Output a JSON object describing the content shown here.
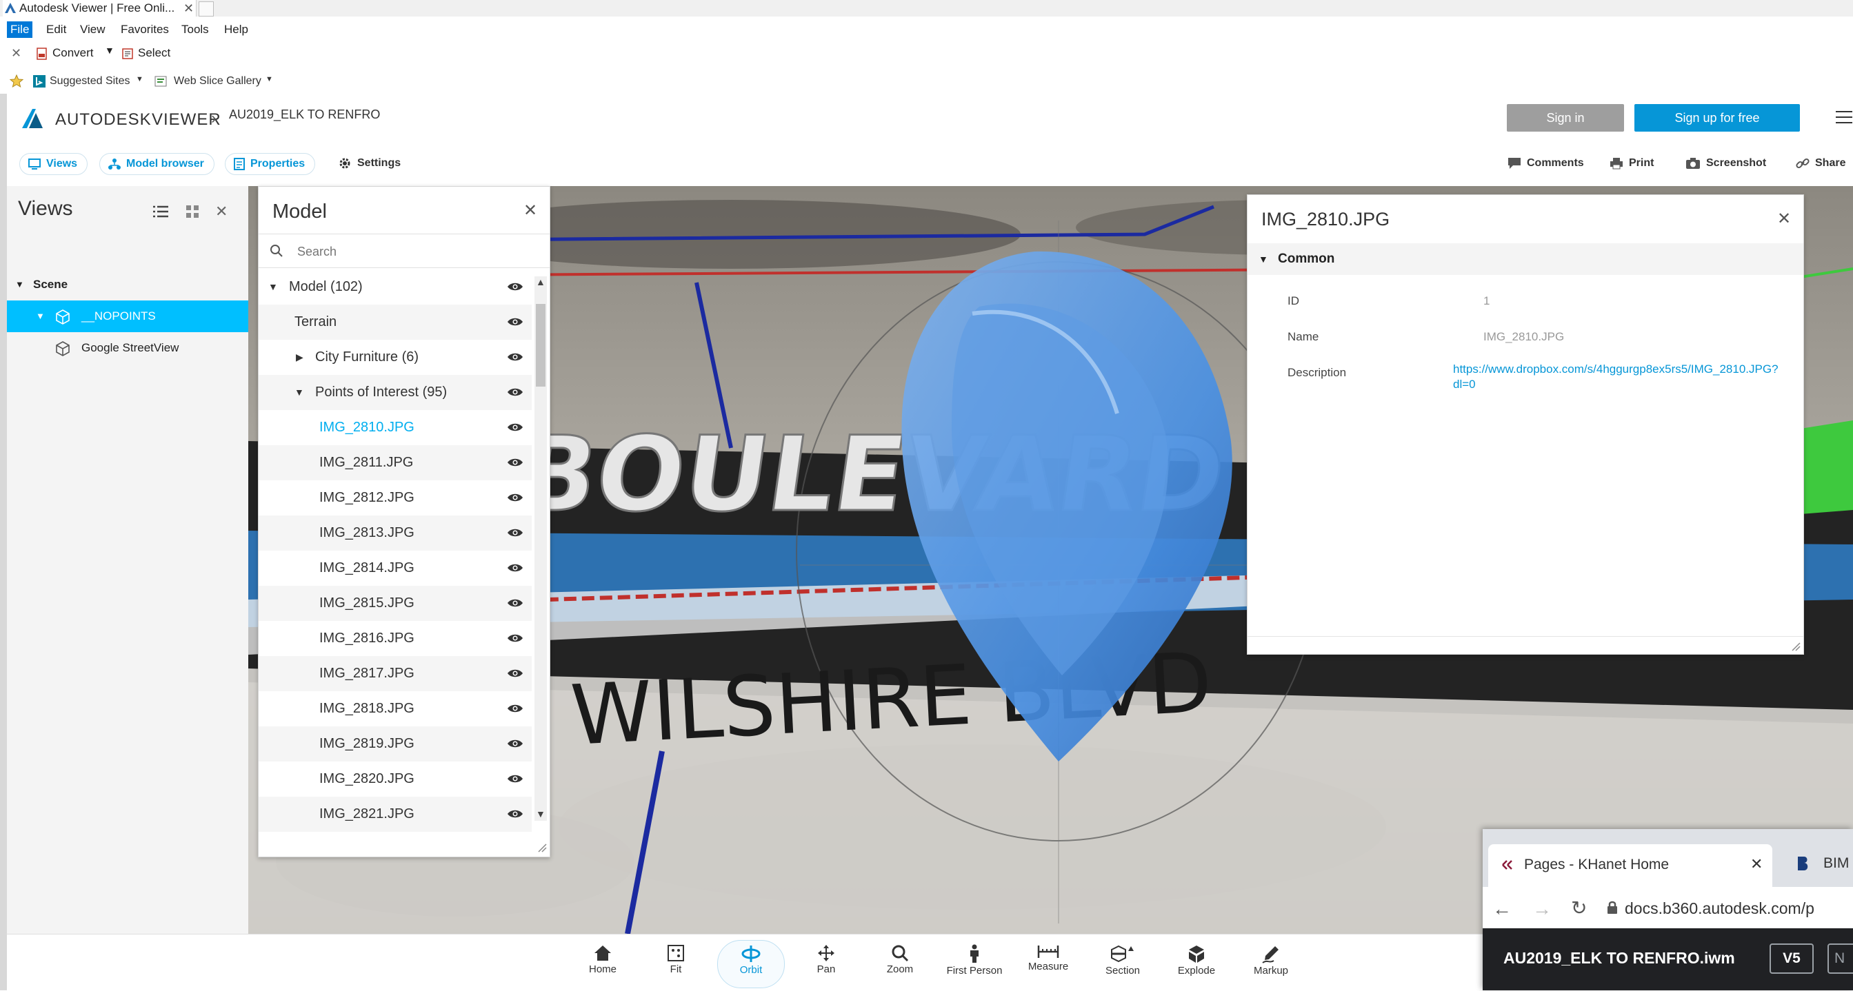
{
  "browser": {
    "tab_title": "Autodesk Viewer | Free Onli...",
    "menu": [
      "File",
      "Edit",
      "View",
      "Favorites",
      "Tools",
      "Help"
    ],
    "command_bar": {
      "convert": "Convert",
      "select": "Select"
    },
    "favorites": {
      "suggested": "Suggested Sites",
      "web_slice": "Web Slice Gallery"
    }
  },
  "viewer": {
    "brand": "AUTODESK",
    "brand_product": "VIEWER",
    "breadcrumb": "AU2019_ELK TO RENFRO",
    "sign_in": "Sign in",
    "sign_up": "Sign up for free",
    "toolbar": {
      "views": "Views",
      "model_browser": "Model browser",
      "properties": "Properties",
      "settings": "Settings",
      "comments": "Comments",
      "print": "Print",
      "screenshot": "Screenshot",
      "share": "Share"
    }
  },
  "views_panel": {
    "title": "Views",
    "scene_label": "Scene",
    "items": [
      {
        "label": "__NOPOINTS",
        "selected": true
      },
      {
        "label": "Google StreetView",
        "selected": false
      }
    ]
  },
  "model_panel": {
    "title": "Model",
    "search_placeholder": "Search",
    "root": "Model (102)",
    "terrain": "Terrain",
    "city_furniture": "City Furniture (6)",
    "points_of_interest": "Points of Interest (95)",
    "items": [
      "IMG_2810.JPG",
      "IMG_2811.JPG",
      "IMG_2812.JPG",
      "IMG_2813.JPG",
      "IMG_2814.JPG",
      "IMG_2815.JPG",
      "IMG_2816.JPG",
      "IMG_2817.JPG",
      "IMG_2818.JPG",
      "IMG_2819.JPG",
      "IMG_2820.JPG",
      "IMG_2821.JPG"
    ]
  },
  "properties_panel": {
    "title": "IMG_2810.JPG",
    "section": "Common",
    "rows": [
      {
        "key": "ID",
        "value": "1"
      },
      {
        "key": "Name",
        "value": "IMG_2810.JPG"
      },
      {
        "key": "Description",
        "value_line1": "https://www.dropbox.com/s/4hggurgp8ex5rs5/IMG_2810.JPG?",
        "value_line2": "dl=0"
      }
    ]
  },
  "scene_text": {
    "sign": "BOULEVARD",
    "street": "WILSHIRE BLVD"
  },
  "nav_tools": [
    "Home",
    "Fit",
    "Orbit",
    "Pan",
    "Zoom",
    "First Person",
    "Measure",
    "Section",
    "Explode",
    "Markup"
  ],
  "popup": {
    "tab_title": "Pages - KHanet Home",
    "tab2_fragment": "BIM",
    "url": "docs.b360.autodesk.com/p",
    "file_name": "AU2019_ELK TO RENFRO.iwm",
    "version": "V5",
    "badge_fragment": "N"
  },
  "colors": {
    "accent": "#0696d7",
    "selected_row": "#00bfff",
    "sign_up": "#0696d7",
    "sign_in": "#9e9e9e",
    "marker": "#4a90e2"
  }
}
